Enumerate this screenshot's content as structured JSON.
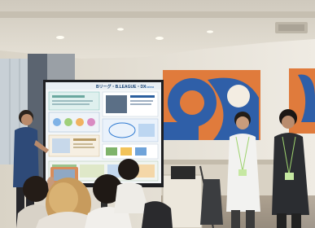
{
  "photo": {
    "setting": "indoor-event-venue",
    "colors": {
      "ceiling": "#ded9cf",
      "wall": "#e9e4da",
      "mural_orange": "#e07b3c",
      "mural_blue": "#2f5fa8",
      "screen_bg": "#f3f6f8",
      "screen_bezel": "#1e1f22",
      "lanyard_green": "#9ed36e"
    }
  },
  "screen": {
    "title_line": "Bリーグ・B.LEAGUE・DX",
    "badge": "Daiwa"
  }
}
